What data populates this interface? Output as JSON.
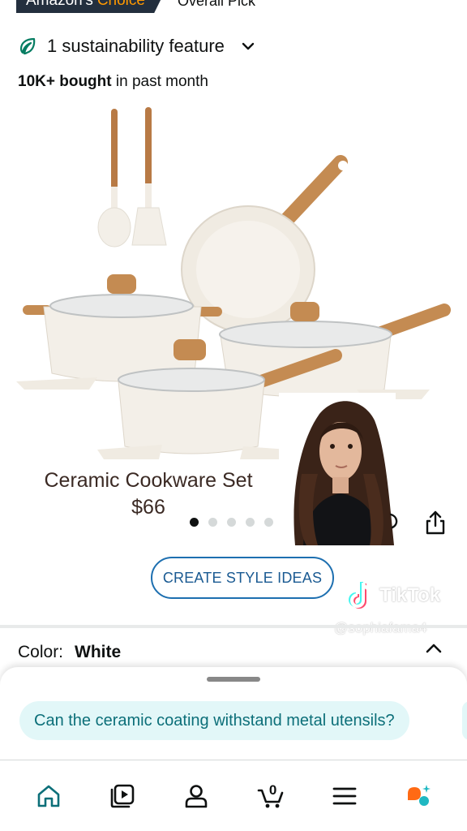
{
  "badges": {
    "choice_prefix": "Amazon's",
    "choice_accent": "Choice",
    "overall_pick": "Overall Pick"
  },
  "sustainability": {
    "label": "1 sustainability feature",
    "icon": "leaf-icon"
  },
  "bought": {
    "count": "10K+ bought",
    "suffix": "in past month"
  },
  "caption": {
    "title": "Ceramic Cookware Set",
    "price": "$66"
  },
  "carousel": {
    "total": 5,
    "active": 1
  },
  "style_button": {
    "label": "CREATE STYLE IDEAS"
  },
  "watermark": {
    "brand": "TikTok",
    "handle": "@sophiafama4"
  },
  "color": {
    "label": "Color:",
    "value": "White"
  },
  "assistant": {
    "question": "Can the ceramic coating withstand metal utensils?"
  },
  "nav": {
    "items": [
      {
        "name": "home",
        "icon": "home-icon"
      },
      {
        "name": "video",
        "icon": "video-icon"
      },
      {
        "name": "account",
        "icon": "person-icon"
      },
      {
        "name": "cart",
        "icon": "cart-icon",
        "count": "0"
      },
      {
        "name": "menu",
        "icon": "menu-icon"
      },
      {
        "name": "rufus",
        "icon": "rufus-icon"
      }
    ]
  },
  "colors": {
    "accent_teal": "#0c6f79",
    "chip_bg": "#e2f7f8",
    "link_blue": "#1a5a92",
    "badge_dark": "#232f3e",
    "badge_orange": "#ff9900",
    "rufus_orange": "#ff6a14"
  }
}
